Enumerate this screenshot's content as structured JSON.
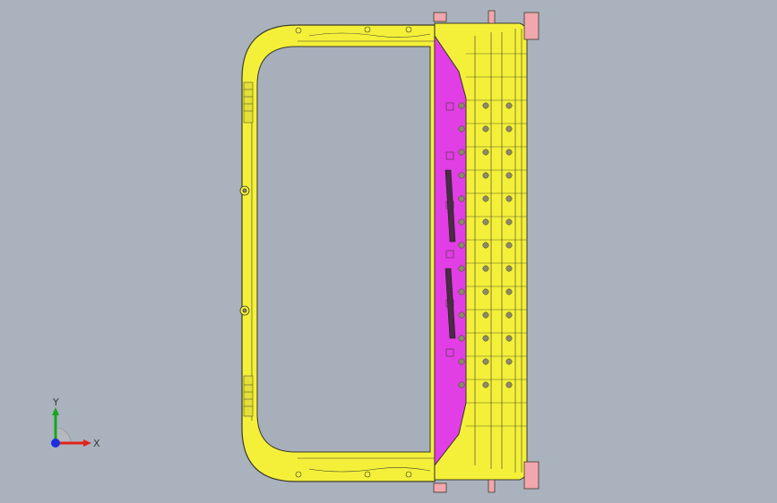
{
  "viewport": {
    "background": "#a9b2bd",
    "part_colors": {
      "frame_yellow": "#f4f03a",
      "frame_outline": "#3b3b2a",
      "inner_magenta": "#e23ee6",
      "bracket_pink": "#f2a6ad",
      "hole_gray": "#8d8a6a"
    }
  },
  "triad": {
    "x_label": "X",
    "y_label": "Y",
    "x_color": "#e0231b",
    "y_color": "#17a51a",
    "z_color": "#1b2fe0"
  }
}
